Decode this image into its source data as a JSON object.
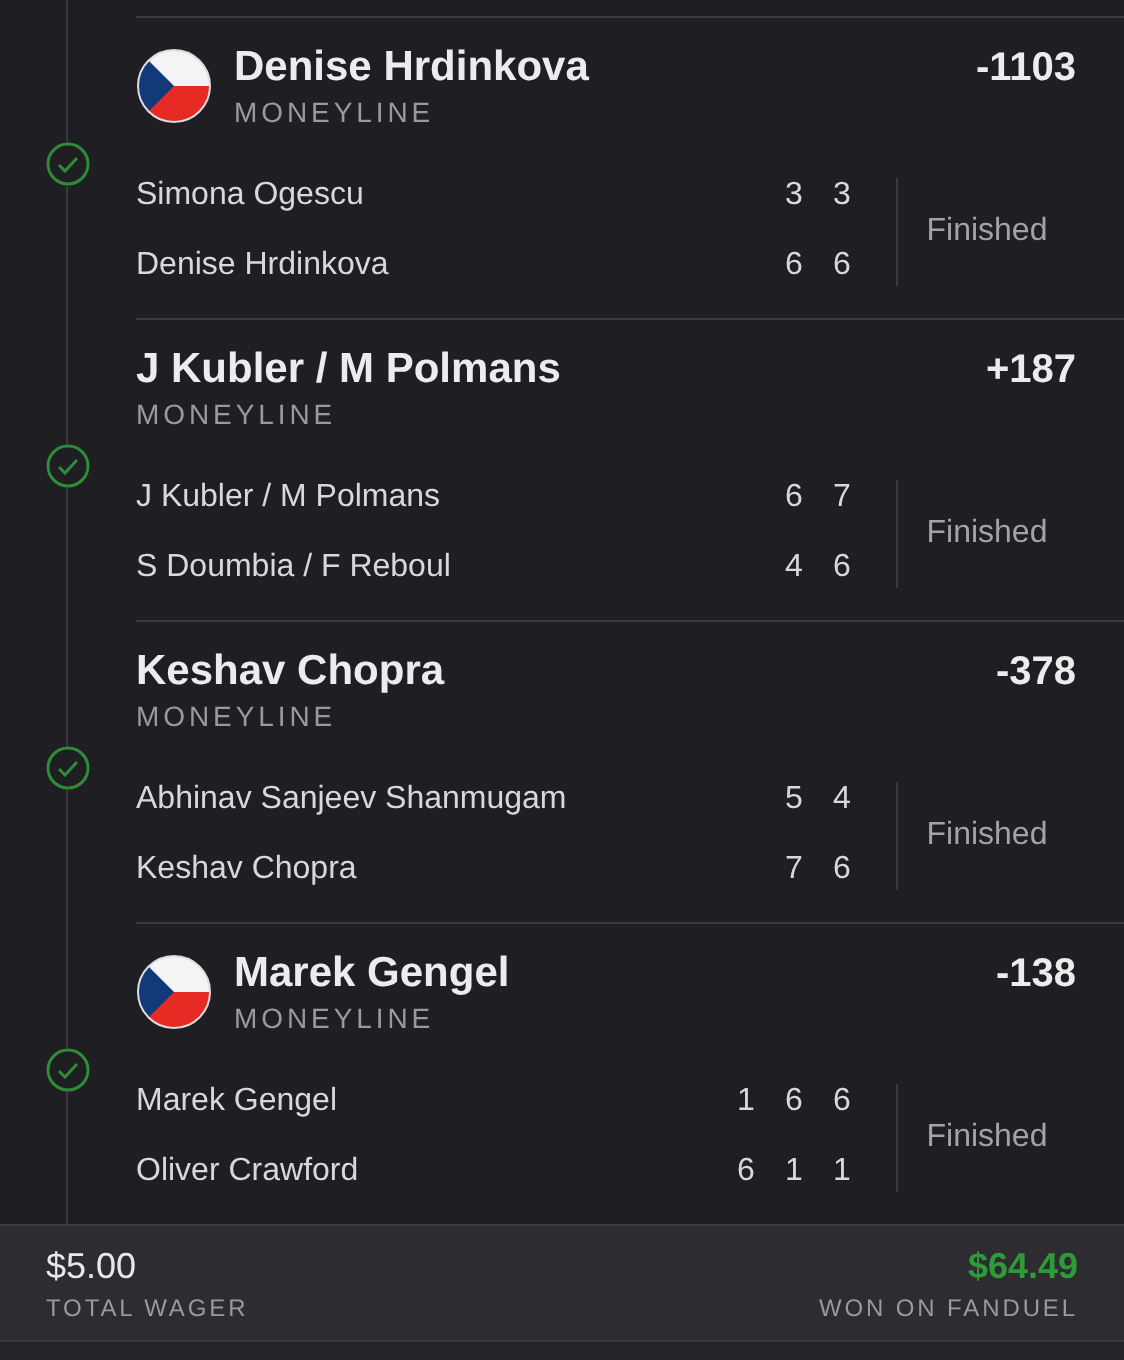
{
  "legs": [
    {
      "selection": "Denise Hrdinkova",
      "flag": true,
      "market": "MONEYLINE",
      "odds": "-1103",
      "won": true,
      "players": [
        {
          "name": "Simona Ogescu",
          "scores": [
            "3",
            "3"
          ]
        },
        {
          "name": "Denise Hrdinkova",
          "scores": [
            "6",
            "6"
          ]
        }
      ],
      "status": "Finished"
    },
    {
      "selection": "J Kubler / M Polmans",
      "flag": false,
      "market": "MONEYLINE",
      "odds": "+187",
      "won": true,
      "players": [
        {
          "name": "J Kubler / M Polmans",
          "scores": [
            "6",
            "7"
          ]
        },
        {
          "name": "S Doumbia / F Reboul",
          "scores": [
            "4",
            "6"
          ]
        }
      ],
      "status": "Finished"
    },
    {
      "selection": "Keshav Chopra",
      "flag": false,
      "market": "MONEYLINE",
      "odds": "-378",
      "won": true,
      "players": [
        {
          "name": "Abhinav Sanjeev Shanmugam",
          "scores": [
            "5",
            "4"
          ]
        },
        {
          "name": "Keshav Chopra",
          "scores": [
            "7",
            "6"
          ]
        }
      ],
      "status": "Finished"
    },
    {
      "selection": "Marek Gengel",
      "flag": true,
      "market": "MONEYLINE",
      "odds": "-138",
      "won": true,
      "players": [
        {
          "name": "Marek Gengel",
          "scores": [
            "1",
            "6",
            "6"
          ]
        },
        {
          "name": "Oliver Crawford",
          "scores": [
            "6",
            "1",
            "1"
          ]
        }
      ],
      "status": "Finished"
    }
  ],
  "footer": {
    "wager": "$5.00",
    "wager_label": "TOTAL WAGER",
    "payout": "$64.49",
    "payout_label": "WON ON FANDUEL"
  }
}
